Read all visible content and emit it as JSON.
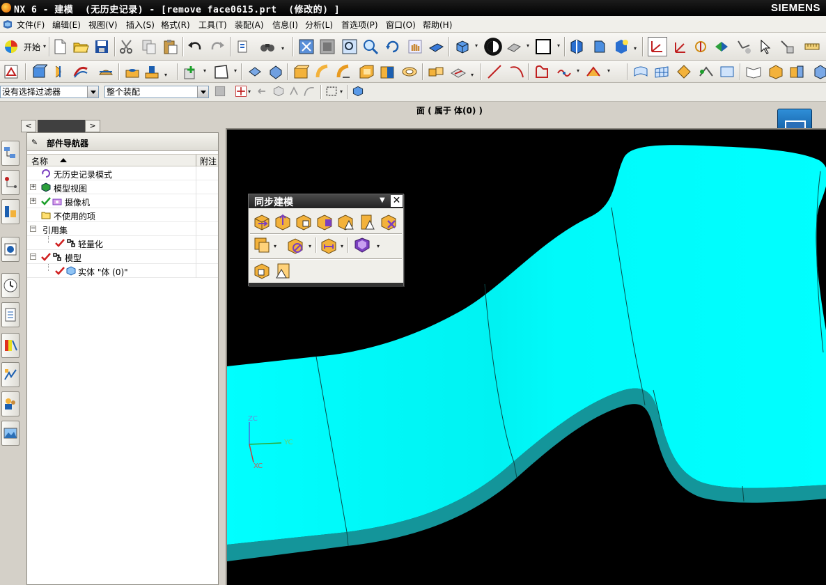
{
  "window": {
    "title": "NX 6 - 建模  (无历史记录) - [remove face0615.prt  (修改的) ]",
    "brand": "SIEMENS"
  },
  "menu": {
    "items": [
      "文件(F)",
      "编辑(E)",
      "视图(V)",
      "插入(S)",
      "格式(R)",
      "工具(T)",
      "装配(A)",
      "信息(I)",
      "分析(L)",
      "首选项(P)",
      "窗口(O)",
      "帮助(H)"
    ]
  },
  "toolbar": {
    "start_label": "开始",
    "selection_filter": "没有选择过滤器",
    "assembly_scope": "整个装配"
  },
  "status": {
    "text": "面 ( 属于 体(0) )"
  },
  "navigator": {
    "title": "部件导航器",
    "col_name": "名称",
    "col_attach": "附注",
    "rows": [
      {
        "label": "无历史记录模式"
      },
      {
        "label": "模型视图"
      },
      {
        "label": "摄像机"
      },
      {
        "label": "不使用的项"
      },
      {
        "label": "引用集"
      },
      {
        "label": "轻量化"
      },
      {
        "label": "模型"
      },
      {
        "label": "实体 \"体 (0)\""
      }
    ]
  },
  "sync_palette": {
    "title": "同步建模"
  },
  "viewport": {
    "background": "#000000",
    "model_color": "#00ffff",
    "model_side_color": "#14959a",
    "triad": {
      "zc": "ZC",
      "yc": "YC",
      "xc": "XC"
    }
  },
  "colors": {
    "titlebar": "#000000",
    "accent": "#0a4f94"
  }
}
